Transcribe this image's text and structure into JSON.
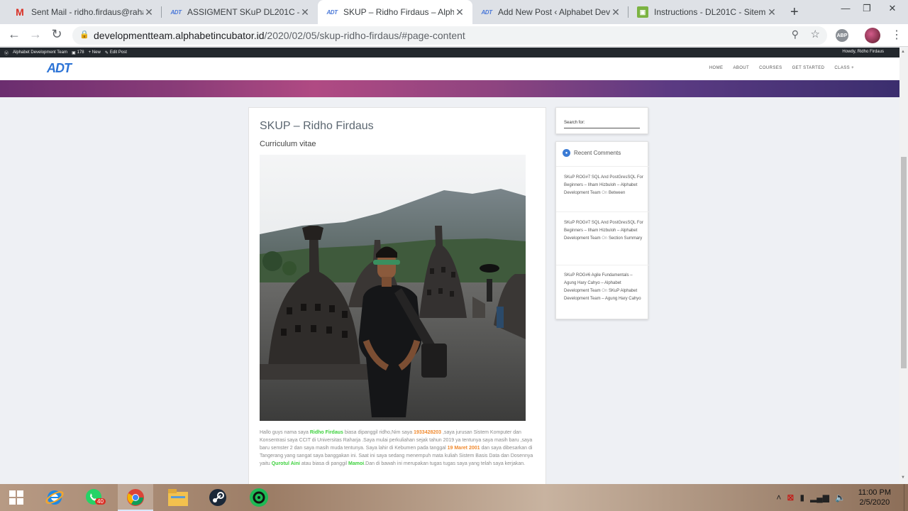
{
  "browser": {
    "tabs": [
      {
        "title": "Sent Mail - ridho.firdaus@rahar",
        "favicon": "gmail-icon",
        "active": false
      },
      {
        "title": "ASSIGMENT SKuP DL201C – Vic",
        "favicon": "adt-icon",
        "active": false
      },
      {
        "title": "SKUP – Ridho Firdaus – Alphabe",
        "favicon": "adt-icon",
        "active": true
      },
      {
        "title": "Add New Post ‹ Alphabet Devel",
        "favicon": "adt-icon",
        "active": false
      },
      {
        "title": "Instructions - DL201C - Sitem B",
        "favicon": "instructions-icon",
        "active": false
      }
    ],
    "url_host": "developmentteam.alphabetincubator.id",
    "url_path": "/2020/02/05/skup-ridho-firdaus/#page-content",
    "abp_label": "ABP"
  },
  "wp_admin": {
    "site_name": "Alphabet Development Team",
    "comments_count": "178",
    "new_label": "+ New",
    "edit_label": "Edit Post",
    "howdy": "Howdy, Ridho Firdaus"
  },
  "site": {
    "logo_text": "ADT",
    "nav": [
      "HOME",
      "ABOUT",
      "COURSES",
      "GET STARTED",
      "CLASS +"
    ]
  },
  "post": {
    "title": "SKUP – Ridho Firdaus",
    "subtitle": "Curriculum vitae",
    "body": {
      "t1": "Hallo guys nama saya ",
      "name": "Ridho Firdaus",
      "t2": " biasa dipanggil ridho,Nim saya ",
      "nim": "1933428203",
      "t3": " ,saya jurusan Sistem Komputer dan Konsentrasi saya CCIT di Universitas Raharja .Saya mulai perkuliahan sejak tahun 2019 ya tentunya saya masih baru ,saya baru semster 2 dan saya masih muda tentunya. Saya lahir di Kebumen pada tanggal ",
      "dob": "19 Maret 2001",
      "t4": " dan saya dibesarkan di Tangerang yang sangat saya banggakan ini. Saat ini saya sedang menempuh mata kuliah Sistem Basis Data dan Dosennya yaitu ",
      "lecturer": "Qurotul Aini",
      "t5": " atau biasa di panggil ",
      "nickname": "Mamoi",
      "t6": ".Dan di bawah ini merupakan tugas tugas saya yang telah saya kerjakan."
    }
  },
  "sidebar": {
    "search_label": "Search for:",
    "comments_title": "Recent Comments",
    "comments": [
      {
        "link": "SKuP ROG#7 SQL And PostGresSQL For Beginners – Ilham Hizbuloh – Alphabet Development Team",
        "on": "On",
        "target": "Between"
      },
      {
        "link": "SKuP ROG#7 SQL And PostGresSQL For Beginners – Ilham Hizbuloh – Alphabet Development Team",
        "on": "On",
        "target": "Section Summary"
      },
      {
        "link": "SKuP ROG#6 Agile Fundamentals – Agung Hary Cahyo – Alphabet Development Team",
        "on": "On",
        "target": "SKuP Alphabet Development Team – Agung Hary Cahyo"
      }
    ]
  },
  "taskbar": {
    "whatsapp_badge": "40",
    "time": "11:00 PM",
    "date": "2/5/2020"
  }
}
